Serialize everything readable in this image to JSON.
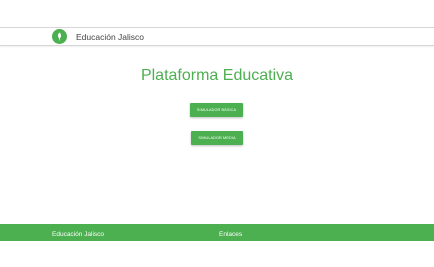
{
  "header": {
    "logo_icon": "leaf-icon",
    "brand": "Educación Jalisco"
  },
  "main": {
    "title": "Plataforma Educativa",
    "buttons": [
      {
        "label": "SIMULADOR BÁSICA"
      },
      {
        "label": "SIMULADOR MEDIA"
      }
    ]
  },
  "footer": {
    "brand": "Educación Jalisco",
    "links_heading": "Enlaces"
  },
  "colors": {
    "accent": "#4caf50",
    "header_text": "#444444",
    "background": "#ffffff"
  }
}
